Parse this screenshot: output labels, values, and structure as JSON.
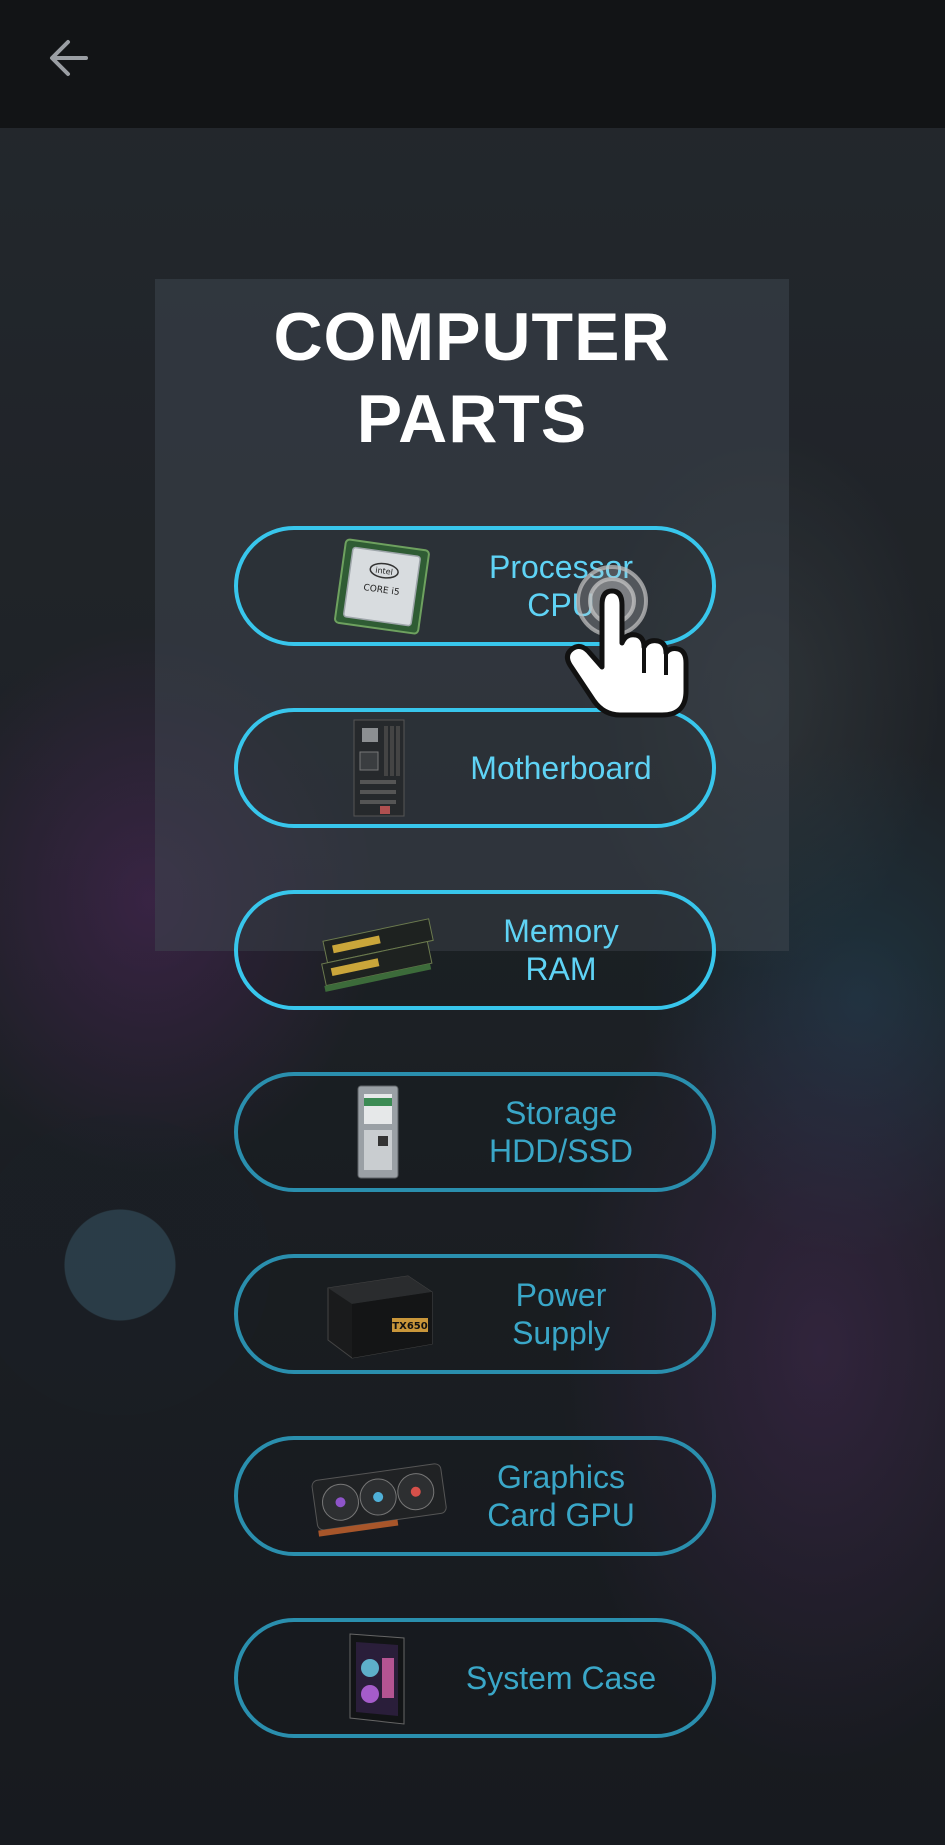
{
  "page_title": [
    "COMPUTER",
    "PARTS"
  ],
  "appbar": {
    "back_icon": "arrow-left-icon"
  },
  "parts": [
    {
      "id": "cpu",
      "label_lines": [
        "Processor",
        "CPU"
      ],
      "image": "cpu-chip-icon"
    },
    {
      "id": "motherboard",
      "label_lines": [
        "Motherboard"
      ],
      "image": "motherboard-icon"
    },
    {
      "id": "ram",
      "label_lines": [
        "Memory",
        "RAM"
      ],
      "image": "ram-stick-icon"
    },
    {
      "id": "storage",
      "label_lines": [
        "Storage",
        "HDD/SSD"
      ],
      "image": "hard-drive-icon"
    },
    {
      "id": "psu",
      "label_lines": [
        "Power",
        "Supply"
      ],
      "image": "power-supply-icon"
    },
    {
      "id": "gpu",
      "label_lines": [
        "Graphics",
        "Card GPU"
      ],
      "image": "graphics-card-icon"
    },
    {
      "id": "case",
      "label_lines": [
        "System Case"
      ],
      "image": "pc-case-icon"
    }
  ],
  "overlay": {
    "pointer_icon": "tap-hand-icon"
  },
  "colors": {
    "accent": "#38c6ec",
    "accent_dim": "#2a8fae",
    "label": "#5fd3f5",
    "appbar": "#121416",
    "title": "#ffffff"
  }
}
